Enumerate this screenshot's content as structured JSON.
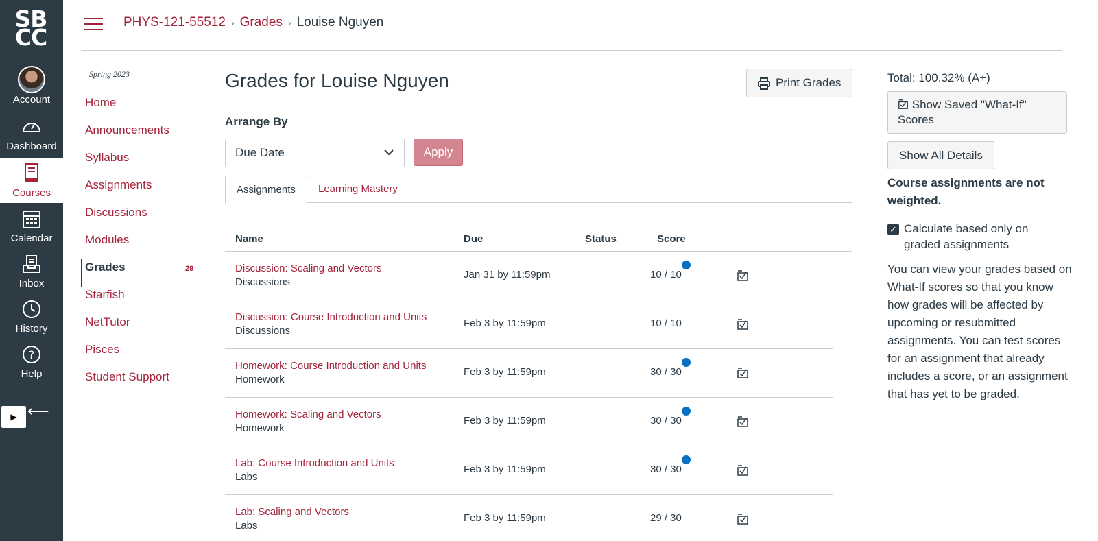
{
  "global_nav": {
    "logo": [
      "SB",
      "CC"
    ],
    "items": [
      {
        "label": "Account"
      },
      {
        "label": "Dashboard"
      },
      {
        "label": "Courses"
      },
      {
        "label": "Calendar"
      },
      {
        "label": "Inbox"
      },
      {
        "label": "History"
      },
      {
        "label": "Help"
      }
    ]
  },
  "breadcrumb": {
    "course": "PHYS-121-55512",
    "section": "Grades",
    "student": "Louise Nguyen"
  },
  "course_nav": {
    "term": "Spring 2023",
    "items": [
      {
        "label": "Home"
      },
      {
        "label": "Announcements"
      },
      {
        "label": "Syllabus"
      },
      {
        "label": "Assignments"
      },
      {
        "label": "Discussions"
      },
      {
        "label": "Modules"
      },
      {
        "label": "Grades",
        "badge": "29"
      },
      {
        "label": "Starfish"
      },
      {
        "label": "NetTutor"
      },
      {
        "label": "Pisces"
      },
      {
        "label": "Student Support"
      }
    ]
  },
  "main": {
    "title": "Grades for Louise Nguyen",
    "print_label": "Print Grades",
    "arrange_label": "Arrange By",
    "arrange_value": "Due Date",
    "apply_label": "Apply",
    "tabs": [
      "Assignments",
      "Learning Mastery"
    ],
    "columns": [
      "Name",
      "Due",
      "Status",
      "Score"
    ],
    "rows": [
      {
        "name": "Discussion: Scaling and Vectors",
        "category": "Discussions",
        "due": "Jan 31 by 11:59pm",
        "score": "10 / 10"
      },
      {
        "name": "Discussion: Course Introduction and Units",
        "category": "Discussions",
        "due": "Feb 3 by 11:59pm",
        "score": "10 / 10"
      },
      {
        "name": "Homework: Course Introduction and Units",
        "category": "Homework",
        "due": "Feb 3 by 11:59pm",
        "score": "30 / 30"
      },
      {
        "name": "Homework: Scaling and Vectors",
        "category": "Homework",
        "due": "Feb 3 by 11:59pm",
        "score": "30 / 30"
      },
      {
        "name": "Lab: Course Introduction and Units",
        "category": "Labs",
        "due": "Feb 3 by 11:59pm",
        "score": "30 / 30"
      },
      {
        "name": "Lab: Scaling and Vectors",
        "category": "Labs",
        "due": "Feb 3 by 11:59pm",
        "score": "29 / 30"
      }
    ]
  },
  "sidebar": {
    "total": "Total: 100.32% (A+)",
    "whatif_label": "Show Saved \"What-If\" Scores",
    "details_label": "Show All Details",
    "not_weighted": "Course assignments are not weighted.",
    "calc_label": "Calculate based only on graded assignments",
    "info": "You can view your grades based on What-If scores so that you know how grades will be affected by upcoming or resubmitted assignments. You can test scores for an assignment that already includes a score, or an assignment that has yet to be graded."
  },
  "colors": {
    "brand": "#a4243b",
    "nav_bg": "#2d3b45",
    "unread_dot": "#0770c0"
  }
}
